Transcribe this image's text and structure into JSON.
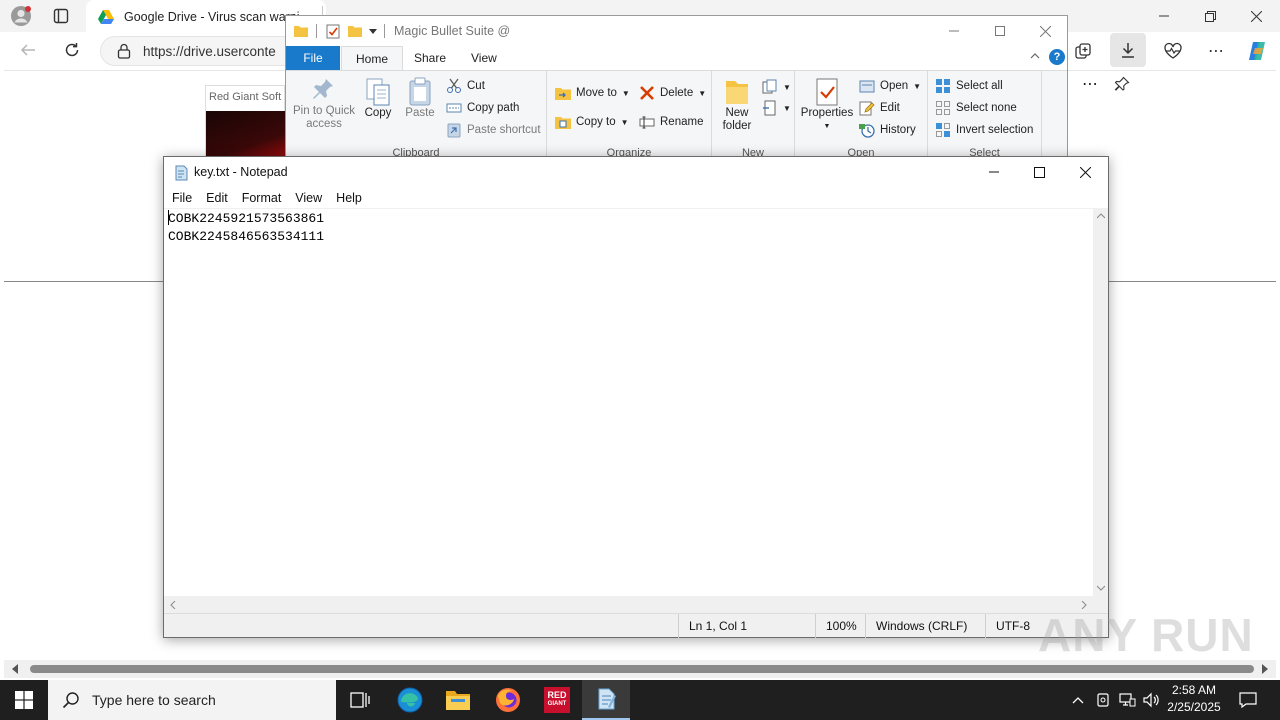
{
  "browser": {
    "tab_title": "Google Drive - Virus scan warni",
    "address": "https://drive.userconte",
    "page_card_title": "Red Giant Soft"
  },
  "explorer": {
    "title": "Magic Bullet Suite @",
    "tabs": {
      "file": "File",
      "home": "Home",
      "share": "Share",
      "view": "View"
    },
    "clipboard": {
      "group_label": "Clipboard",
      "pin": "Pin to Quick access",
      "copy": "Copy",
      "paste": "Paste",
      "cut": "Cut",
      "copy_path": "Copy path",
      "paste_shortcut": "Paste shortcut"
    },
    "organize": {
      "group_label": "Organize",
      "move_to": "Move to",
      "copy_to": "Copy to",
      "delete": "Delete",
      "rename": "Rename"
    },
    "new": {
      "group_label": "New",
      "new_folder": "New folder"
    },
    "open": {
      "group_label": "Open",
      "properties": "Properties",
      "open": "Open",
      "edit": "Edit",
      "history": "History"
    },
    "select": {
      "group_label": "Select",
      "select_all": "Select all",
      "select_none": "Select none",
      "invert_selection": "Invert selection"
    }
  },
  "notepad": {
    "title": "key.txt - Notepad",
    "menu": [
      "File",
      "Edit",
      "Format",
      "View",
      "Help"
    ],
    "lines": [
      "COBK2245921573563861",
      "COBK2245846563534111"
    ],
    "status": {
      "position": "Ln 1, Col 1",
      "zoom": "100%",
      "line_ending": "Windows (CRLF)",
      "encoding": "UTF-8"
    }
  },
  "taskbar": {
    "search_placeholder": "Type here to search",
    "time": "2:58 AM",
    "date": "2/25/2025",
    "apps": [
      "task-view",
      "edge",
      "file-explorer",
      "firefox",
      "red-giant",
      "notepad"
    ]
  },
  "watermark": "ANY RUN",
  "colors": {
    "taskbar": "#1f1f1f",
    "explorer_file_tab": "#1979ca",
    "delete_red": "#d83b01",
    "red_giant": "#c8102e"
  }
}
